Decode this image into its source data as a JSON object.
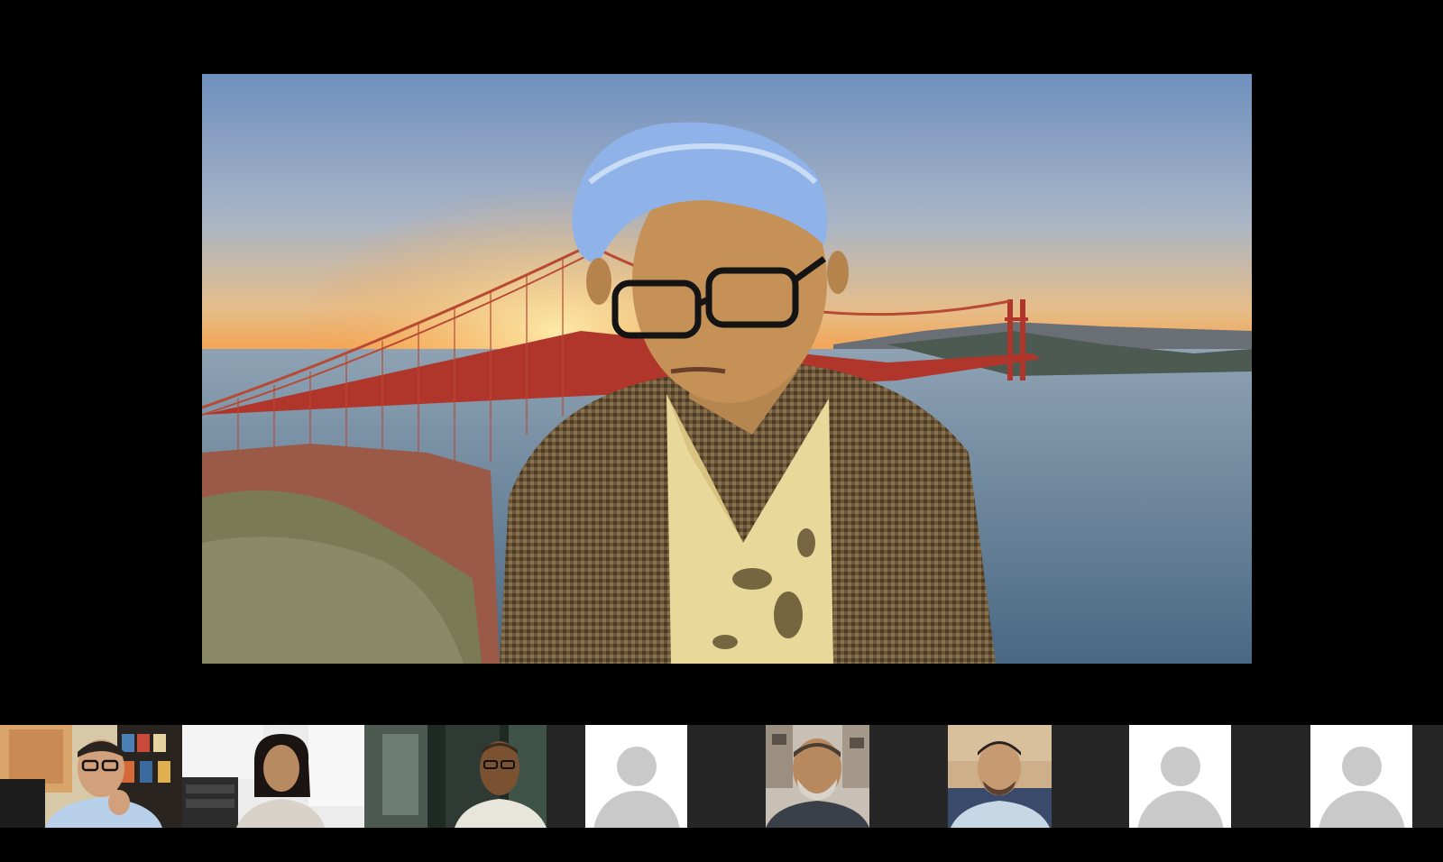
{
  "meeting": {
    "active_speaker": {
      "background": "golden-gate-bridge-virtual-background",
      "camera": "on"
    },
    "participants": [
      {
        "slot": 1,
        "camera": "on",
        "appearance": "man-with-glasses-bookshelf-background"
      },
      {
        "slot": 2,
        "camera": "on",
        "appearance": "woman-white-room-background"
      },
      {
        "slot": 3,
        "camera": "on",
        "appearance": "man-with-glasses-blurred-background"
      },
      {
        "slot": 4,
        "camera": "off",
        "icon": "default-avatar-icon"
      },
      {
        "slot": 5,
        "camera": "on",
        "appearance": "man-with-grey-beard-street-background"
      },
      {
        "slot": 6,
        "camera": "on",
        "appearance": "man-light-shirt-wood-background"
      },
      {
        "slot": 7,
        "camera": "off",
        "icon": "default-avatar-icon"
      },
      {
        "slot": 8,
        "camera": "off",
        "icon": "default-avatar-icon"
      }
    ]
  },
  "colors": {
    "background": "#000000",
    "strip_background": "#1a1a1a",
    "avatar_tile": "#ffffff",
    "avatar_silhouette": "#c9c9c9"
  }
}
